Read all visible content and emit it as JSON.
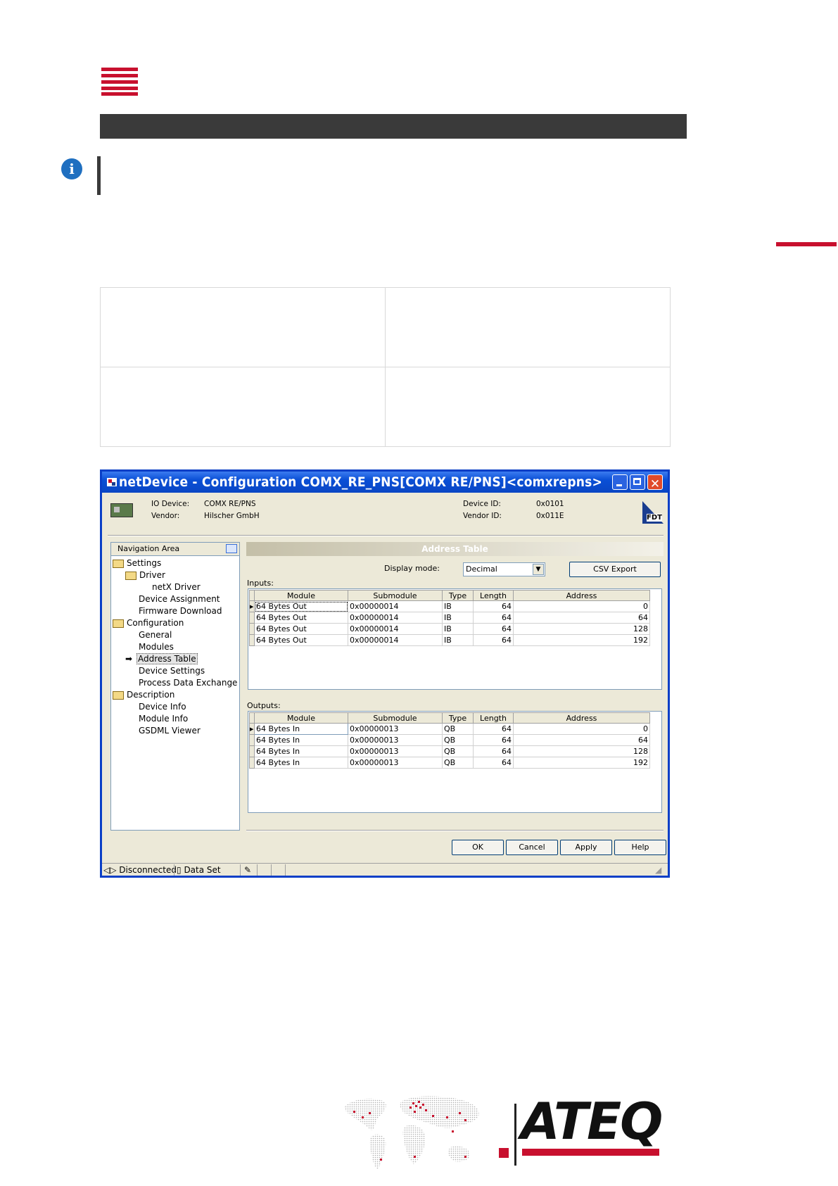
{
  "window": {
    "title": "netDevice - Configuration COMX_RE_PNS[COMX RE/PNS]<comxrepns>",
    "device": {
      "io_device_label": "IO Device:",
      "io_device_value": "COMX RE/PNS",
      "vendor_label": "Vendor:",
      "vendor_value": "Hilscher GmbH",
      "device_id_label": "Device ID:",
      "device_id_value": "0x0101",
      "vendor_id_label": "Vendor ID:",
      "vendor_id_value": "0x011E",
      "fdt_logo": "FDT"
    },
    "nav": {
      "header": "Navigation Area",
      "items": [
        {
          "label": "Settings"
        },
        {
          "label": "Driver"
        },
        {
          "label": "netX Driver"
        },
        {
          "label": "Device Assignment"
        },
        {
          "label": "Firmware Download"
        },
        {
          "label": "Configuration"
        },
        {
          "label": "General"
        },
        {
          "label": "Modules"
        },
        {
          "label": "Address Table"
        },
        {
          "label": "Device Settings"
        },
        {
          "label": "Process Data Exchange"
        },
        {
          "label": "Description"
        },
        {
          "label": "Device Info"
        },
        {
          "label": "Module Info"
        },
        {
          "label": "GSDML Viewer"
        }
      ]
    },
    "content": {
      "header": "Address Table",
      "display_mode_label": "Display mode:",
      "display_mode_value": "Decimal",
      "csv_export": "CSV Export",
      "inputs_label": "Inputs:",
      "outputs_label": "Outputs:",
      "columns": [
        "Module",
        "Submodule",
        "Type",
        "Length",
        "Address"
      ],
      "inputs": [
        [
          "64 Bytes Out",
          "0x00000014",
          "IB",
          "64",
          "0"
        ],
        [
          "64 Bytes Out",
          "0x00000014",
          "IB",
          "64",
          "64"
        ],
        [
          "64 Bytes Out",
          "0x00000014",
          "IB",
          "64",
          "128"
        ],
        [
          "64 Bytes Out",
          "0x00000014",
          "IB",
          "64",
          "192"
        ]
      ],
      "outputs": [
        [
          "64 Bytes In",
          "0x00000013",
          "QB",
          "64",
          "0"
        ],
        [
          "64 Bytes In",
          "0x00000013",
          "QB",
          "64",
          "64"
        ],
        [
          "64 Bytes In",
          "0x00000013",
          "QB",
          "64",
          "128"
        ],
        [
          "64 Bytes In",
          "0x00000013",
          "QB",
          "64",
          "192"
        ]
      ]
    },
    "buttons": {
      "ok": "OK",
      "cancel": "Cancel",
      "apply": "Apply",
      "help": "Help"
    },
    "status": {
      "connection": "Disconnected",
      "data_set": "Data Set"
    }
  },
  "footer": {
    "logo_text": "ATEQ"
  },
  "colors": {
    "accent": "#c8102e",
    "dark_bar": "#3a3a3a",
    "info_blue": "#1f6fc0",
    "xp_blue": "#0a4fd6"
  }
}
